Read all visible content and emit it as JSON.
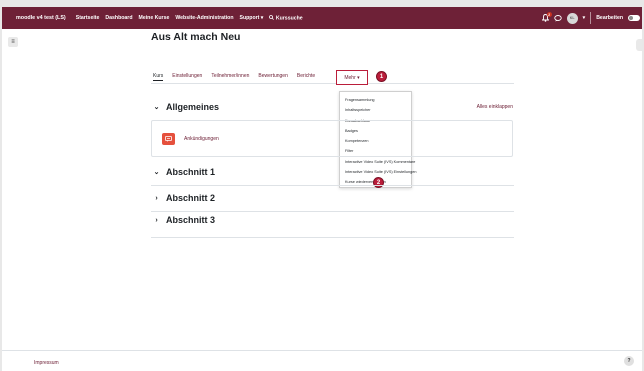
{
  "navbar": {
    "brand": "moodle v4 test (LS)",
    "items": [
      "Startseite",
      "Dashboard",
      "Meine Kurse",
      "Website-Administration",
      "Support ▾",
      "Kurssuche"
    ],
    "notifications_count": "2",
    "avatar_initials": "KL",
    "edit_mode_label": "Bearbeiten"
  },
  "page": {
    "title": "Aus Alt mach Neu"
  },
  "tabs": [
    "Kurs",
    "Einstellungen",
    "Teilnehmer/innen",
    "Bewertungen",
    "Berichte"
  ],
  "more_tab_label": "Mehr ▾",
  "markers": [
    "1",
    "2"
  ],
  "more_menu": [
    "Fragensammlung",
    "Inhaltsspeicher",
    "Kursabschluss",
    "Badges",
    "Kompetenzen",
    "Filter",
    "Interactive Video Suite (IVS) Kommentare",
    "Interactive Video Suite (IVS) Einstellungen",
    "Kurse wiederverwenden"
  ],
  "sections": {
    "general_title": "Allgemeines",
    "collapse_all": "Alles einklappen",
    "announcements": "Ankündigungen",
    "list": [
      "Abschnitt 1",
      "Abschnitt 2",
      "Abschnitt 3"
    ]
  },
  "footer": {
    "imprint": "Impressum",
    "help": "?"
  },
  "colors": {
    "brand": "#6e2137",
    "marker": "#ba1d3a",
    "activity_icon": "#e5503d"
  }
}
